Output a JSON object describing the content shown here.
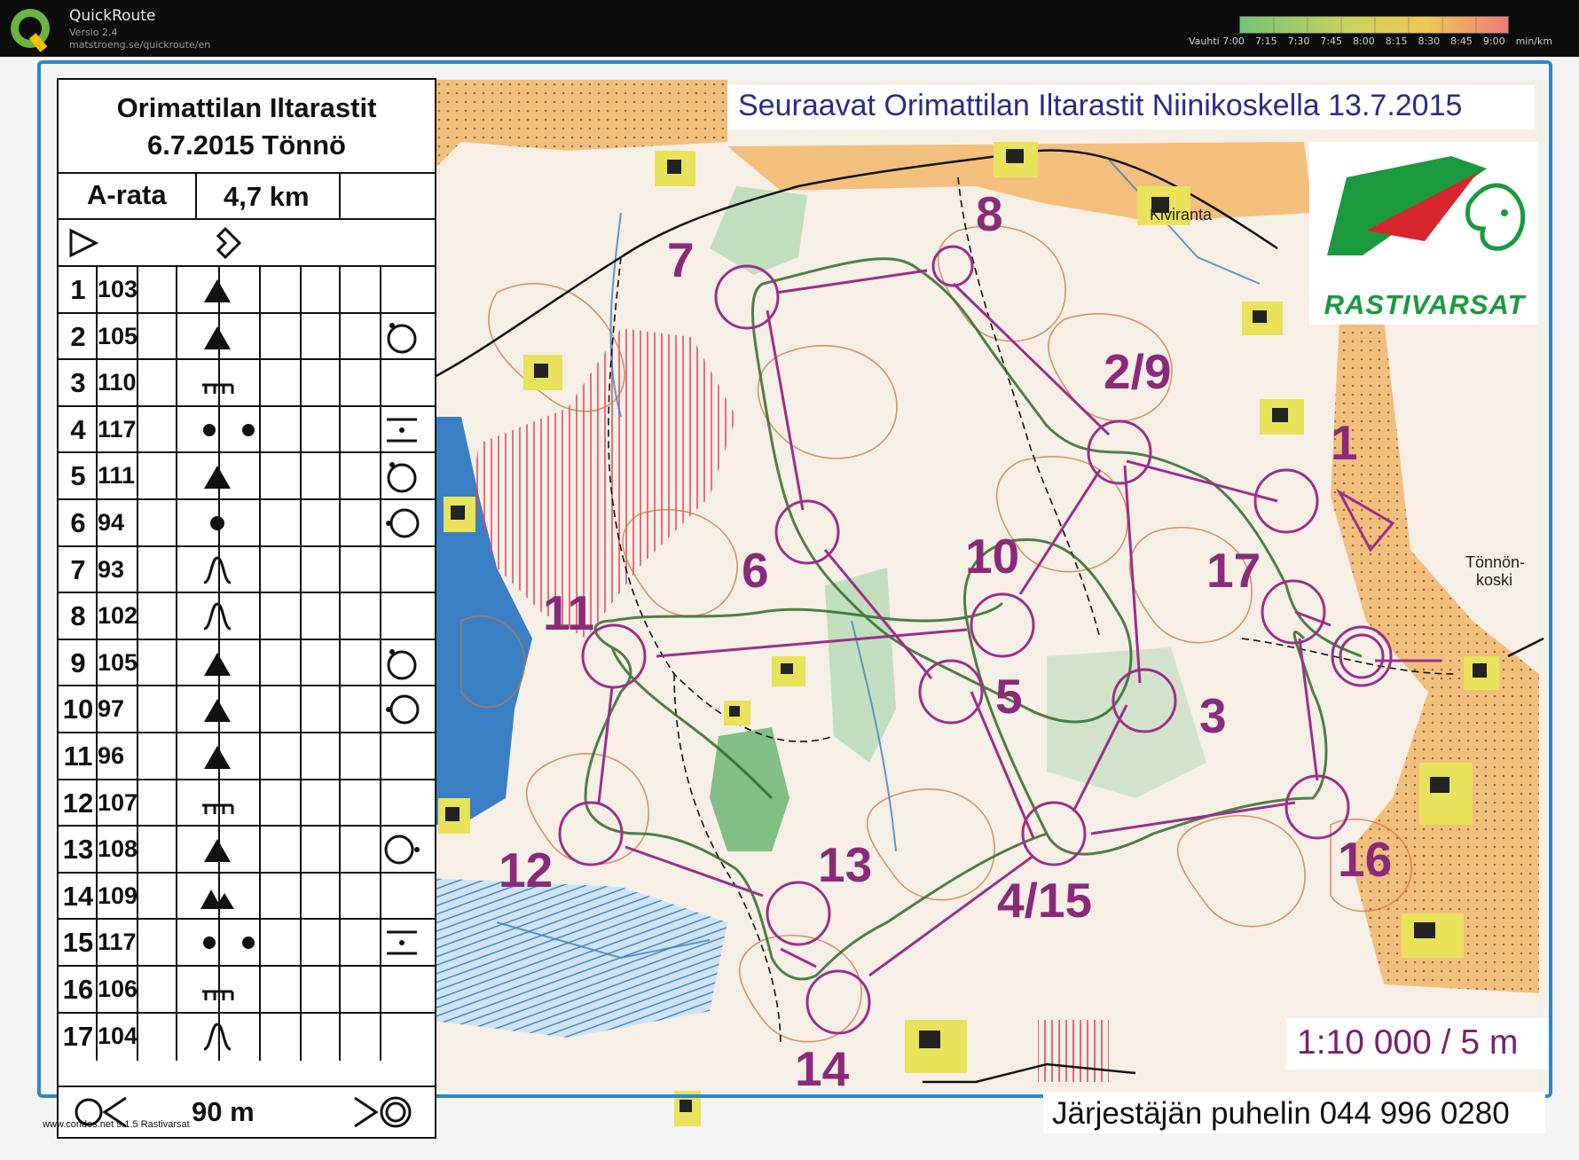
{
  "app": {
    "name": "QuickRoute",
    "version": "Versio 2.4",
    "url": "matstroeng.se/quickroute/en",
    "pace_legend": [
      "Vauhti 7:00",
      "7:15",
      "7:30",
      "7:45",
      "8:00",
      "8:15",
      "8:30",
      "8:45",
      "9:00",
      "min/km"
    ]
  },
  "control_description": {
    "event_name": "Orimattilan Iltarastit",
    "event_date_place": "6.7.2015 Tönnö",
    "course": "A-rata",
    "length": "4,7 km",
    "controls": [
      {
        "num": "1",
        "code": "103"
      },
      {
        "num": "2",
        "code": "105"
      },
      {
        "num": "3",
        "code": "110"
      },
      {
        "num": "4",
        "code": "117"
      },
      {
        "num": "5",
        "code": "111"
      },
      {
        "num": "6",
        "code": "94"
      },
      {
        "num": "7",
        "code": "93"
      },
      {
        "num": "8",
        "code": "102"
      },
      {
        "num": "9",
        "code": "105"
      },
      {
        "num": "10",
        "code": "97"
      },
      {
        "num": "11",
        "code": "96"
      },
      {
        "num": "12",
        "code": "107"
      },
      {
        "num": "13",
        "code": "108"
      },
      {
        "num": "14",
        "code": "109"
      },
      {
        "num": "15",
        "code": "117"
      },
      {
        "num": "16",
        "code": "106"
      },
      {
        "num": "17",
        "code": "104"
      }
    ],
    "finish_distance": "90 m",
    "footer": "www.condes.net 9.1.5 Rastivarsat"
  },
  "map": {
    "next_event": "Seuraavat Orimattilan Iltarastit Niinikoskella 13.7.2015",
    "club": "RASTIVARSAT",
    "scale": "1:10 000 / 5 m",
    "phone": "Järjestäjän puhelin 044 996 0280",
    "place_names": [
      "Kiviranta",
      "Tönnön-",
      "koski"
    ],
    "control_labels": [
      "1",
      "2/9",
      "3",
      "4/15",
      "5",
      "6",
      "7",
      "8",
      "10",
      "11",
      "12",
      "13",
      "14",
      "16",
      "17"
    ],
    "colors": {
      "course": "#9b2f8a",
      "frame": "#2e86c8",
      "water": "#3a7fc4",
      "green": "#64b36b",
      "contour": "#c7773d",
      "route": "#2f6b2a"
    }
  }
}
